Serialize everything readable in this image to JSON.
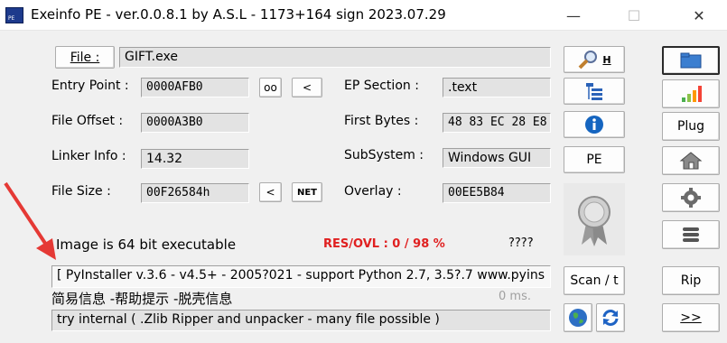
{
  "window": {
    "title": "Exeinfo PE - ver.0.0.8.1  by A.S.L -  1173+164 sign  2023.07.29",
    "minimize": "—",
    "maximize": "☐",
    "close": "✕",
    "app_icon_text": "PE"
  },
  "file": {
    "button_label": "File :",
    "value": "GIFT.exe"
  },
  "entry_point": {
    "label": "Entry Point :",
    "value": "0000AFB0",
    "oo_button": "oo",
    "lt_button": "<"
  },
  "file_offset": {
    "label": "File Offset :",
    "value": "0000A3B0"
  },
  "linker_info": {
    "label": "Linker Info :",
    "value": "14.32"
  },
  "file_size": {
    "label": "File Size :",
    "value": "00F26584h",
    "lt_button": "<",
    "net_button": "NET"
  },
  "ep_section": {
    "label": "EP Section :",
    "value": ".text"
  },
  "first_bytes": {
    "label": "First Bytes :",
    "value": "48 83 EC 28 E8"
  },
  "subsystem": {
    "label": "SubSystem :",
    "value": "Windows GUI"
  },
  "overlay": {
    "label": "Overlay :",
    "value": "00EE5B84"
  },
  "status": {
    "image_info": "Image is 64 bit executable",
    "res_ovl": "RES/OVL : 0 / 98 %",
    "unknown": "????",
    "detection": "[ PyInstaller v.3.6 - v4.5+ - 2005?021 - support Python 2.7, 3.5?.7 www.pyins",
    "chinese_info": "简易信息 -帮助提示 -脱壳信息",
    "time": "0 ms.",
    "hint": "try internal ( .Zlib Ripper and unpacker - many file possible )"
  },
  "middle_buttons": {
    "search_suffix": "H",
    "pe_label": "PE",
    "scan_label": "Scan / t"
  },
  "right_buttons": {
    "plug_label": "Plug",
    "rip_label": "Rip",
    "next_label": ">>"
  },
  "colors": {
    "accent_red": "#e02020",
    "arrow_red": "#e53935",
    "info_blue": "#1565c0"
  }
}
